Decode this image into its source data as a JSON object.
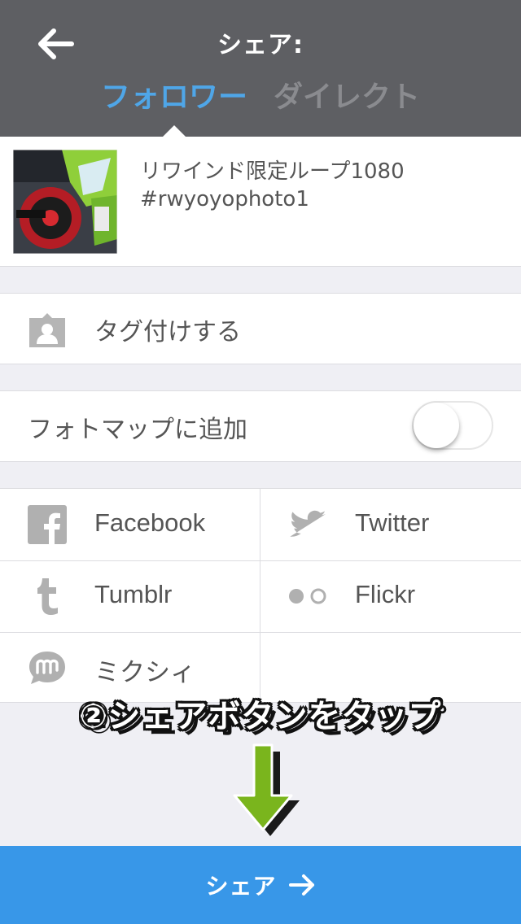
{
  "header": {
    "title": "シェア:",
    "tabs": [
      {
        "label": "フォロワー",
        "active": true
      },
      {
        "label": "ダイレクト",
        "active": false
      }
    ]
  },
  "post": {
    "caption": "リワインド限定ループ1080\n#rwyoyophoto1"
  },
  "options": {
    "tag_people": "タグ付けする",
    "photo_map": "フォトマップに追加",
    "photo_map_enabled": false
  },
  "share_targets": [
    {
      "label": "Facebook",
      "icon": "facebook-icon"
    },
    {
      "label": "Twitter",
      "icon": "twitter-icon"
    },
    {
      "label": "Tumblr",
      "icon": "tumblr-icon"
    },
    {
      "label": "Flickr",
      "icon": "flickr-icon"
    },
    {
      "label": "ミクシィ",
      "icon": "mixi-icon"
    }
  ],
  "annotation": {
    "text": "②シェアボタンをタップ"
  },
  "share_button": {
    "label": "シェア"
  },
  "colors": {
    "header": "#5e5f63",
    "accent": "#4fa6e8",
    "share_button": "#3897e8",
    "annotation_arrow": "#7ab51d"
  }
}
